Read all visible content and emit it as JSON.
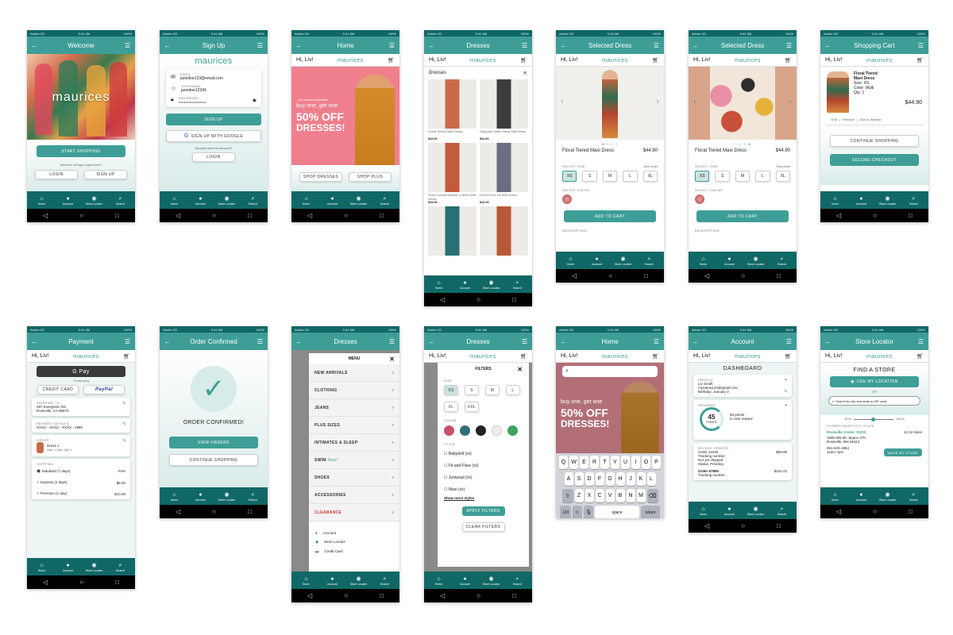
{
  "status": {
    "carrier": "Adobe XD",
    "time": "9:41 AM",
    "battery": "100%"
  },
  "brand": "maurices",
  "greeting": "Hi, Liv!",
  "nav": [
    {
      "label": "Home",
      "icon": "home-icon",
      "glyph": "⌂"
    },
    {
      "label": "Account",
      "icon": "account-icon",
      "glyph": "●"
    },
    {
      "label": "Store Locator",
      "icon": "location-pin-icon",
      "glyph": "◉"
    },
    {
      "label": "Search",
      "icon": "search-icon",
      "glyph": "⌕"
    }
  ],
  "screens": {
    "welcome": {
      "title": "Welcome",
      "logo": "maurices",
      "start": "START SHOPPING",
      "question": "Want the full app experience?",
      "login": "LOGIN",
      "signup": "SIGN UP"
    },
    "signup": {
      "title": "Sign Up",
      "email_label": "EMAIL",
      "email": "janedoe123@email.com",
      "user_label": "USERNAME",
      "user": "janedoe12345",
      "pass_label": "PASSWORD",
      "pass": "•••••••••••••••••••••••••",
      "signup": "SIGN UP",
      "google": "SIGN UP WITH GOOGLE",
      "have": "Already have an account?",
      "login": "LOGIN"
    },
    "home": {
      "title": "Home",
      "small": "your summer destination",
      "promo": "buy one, get one",
      "off": "50% OFF",
      "dresses": "DRESSES!",
      "shop_dresses": "SHOP DRESSES",
      "shop_plus": "SHOP PLUS"
    },
    "dresses": {
      "title": "Dresses",
      "heading": "Dresses",
      "items": [
        {
          "name": "Floral Tiered Maxi Dress",
          "price": "$44.90",
          "color": "#c96b4a"
        },
        {
          "name": "Gingham Halter Neck Midi Dress",
          "price": "$44.90",
          "color": "#3c3c3c"
        },
        {
          "name": "Solid Crochet Bodice V Neck Midi Dress",
          "price": "$44.90",
          "color": "#c45a3e"
        },
        {
          "name": "Floral Front Tie Midi Dress",
          "price": "$44.90",
          "color": "#6a6e80"
        },
        {
          "name": "",
          "price": "",
          "color": "#2a6f74"
        },
        {
          "name": "",
          "price": "",
          "color": "#b85a35"
        }
      ]
    },
    "selected1": {
      "title": "Selected Dress",
      "name": "Floral Tiered Maxi Dress",
      "price": "$44.90",
      "select_size": "SELECT SIZE",
      "size_chart": "Size chart",
      "sizes": [
        "XS",
        "S",
        "M",
        "L",
        "XL"
      ],
      "select_color": "SELECT COLOR",
      "add": "ADD TO CART",
      "desc": "DESCRIPTION"
    },
    "selected2": {
      "title": "Selected Dress",
      "name": "Floral Tiered Maxi Dress",
      "price": "$44.90",
      "select_size": "SELECT SIZE",
      "size_chart": "Size chart",
      "sizes": [
        "XS",
        "S",
        "M",
        "L",
        "XL"
      ],
      "select_color": "SELECT COLOR",
      "add": "ADD TO CART",
      "desc": "DESCRIPTION"
    },
    "cart": {
      "title": "Shopping Cart",
      "item": "Floral Tiered Maxi Dress",
      "size": "Size: XS",
      "color": "Color: Multi",
      "qty": "Qty: 1",
      "price": "$44.90",
      "edit": "Edit",
      "remove": "Remove",
      "wish": "Add to Wishlist",
      "continue": "CONTINUE SHOPPING",
      "checkout": "SECURE CHECKOUT"
    },
    "payment": {
      "title": "Payment",
      "gpay": "G Pay",
      "or": "Or pay using",
      "credit": "CREDIT CARD",
      "paypal": "PayPal",
      "ship_label": "SHIPPING TO:",
      "ship1": "497 Evergreen Rd.",
      "ship2": "Roseville, CA 95673",
      "pay_label": "PAYMENT DETAILS",
      "card": "XXXX - XXXX - XXXX - 1980",
      "order_label": "ORDER",
      "order_item": "Dress 1",
      "order_meta": "Size, Color, Qty 1",
      "shipping_label": "SHIPPING",
      "options": [
        {
          "name": "Standard (7 days)",
          "price": "Free"
        },
        {
          "name": "Express (2 days)",
          "price": "$5.00"
        },
        {
          "name": "Premium (1 day)",
          "price": "$10.00"
        }
      ]
    },
    "confirmed": {
      "title": "Order Confirmed",
      "msg": "ORDER CONFIRMED!",
      "view": "VIEW ORDERS",
      "continue": "CONTINUE SHOPPING"
    },
    "menu": {
      "title": "Dresses",
      "menu": "MENU",
      "items": [
        "NEW ARRIVALS",
        "CLOTHING",
        "JEANS",
        "PLUS SIZES",
        "INTIMATES & SLEEP",
        "SWIM",
        "SHOES",
        "ACCESSORIES",
        "CLEARANCE"
      ],
      "swim_new": "New!",
      "links": [
        "Account",
        "Store Locator",
        "Credit Card"
      ]
    },
    "filters": {
      "title": "Dresses",
      "heading": "FILTERS",
      "size": "SIZE",
      "sizes": [
        "XS",
        "S",
        "M",
        "L",
        "XL",
        "XXL"
      ],
      "color": "COLOR",
      "style": "STYLE",
      "styles": [
        "Babydoll (xx)",
        "Fit and Flare (xx)",
        "Jumpsuit (xx)",
        "Maxi (xx)"
      ],
      "more": "Show more styles",
      "apply": "APPLY FILTERS",
      "clear": "CLEAR FILTERS"
    },
    "search": {
      "title": "Home",
      "promo": "buy one, get one",
      "off": "50% OFF",
      "dresses": "DRESSES!",
      "rows": [
        [
          "Q",
          "W",
          "E",
          "R",
          "T",
          "Y",
          "U",
          "I",
          "O",
          "P"
        ],
        [
          "A",
          "S",
          "D",
          "F",
          "G",
          "H",
          "J",
          "K",
          "L"
        ],
        [
          "Z",
          "X",
          "C",
          "V",
          "B",
          "N",
          "M"
        ]
      ],
      "num": "123",
      "space": "space",
      "ret": "return"
    },
    "account": {
      "title": "Account",
      "dashboard": "DASHBOARD",
      "profile": "PROFILE",
      "pname": "Liv Smith",
      "pemail": "myname123@gmail.com",
      "bday": "Birthday: January 2",
      "rewards": "REWARDS",
      "points": "45",
      "points_lbl": "POINTS",
      "next": "55 points",
      "next2": "to next reward",
      "recent": "RECENT ORDERS",
      "o1": "Order 12345",
      "o1p": "$58.98",
      "o1t": "Tracking number:",
      "o1s": "Not yet shipped",
      "o1st": "Status: Pending",
      "o2": "Order 67890",
      "o2p": "$102.43",
      "o2t": "Tracking number:"
    },
    "store": {
      "title": "Store Locator",
      "find": "FIND A STORE",
      "use": "USE MY LOCATION",
      "or": "OR",
      "search": "Search by city and state or ZIP code",
      "r1": "25 mi",
      "r2": "100 mi",
      "near": "STORES NEAR CITY, STATE",
      "sname": "Roseville Center #2220",
      "dist": "12.34 miles",
      "a1": "1595 MN-36, Space 470,",
      "a2": "Roseville, MN 55113",
      "phone": "651-633-1964",
      "hours": "11am-7pm",
      "make": "MAKE MY STORE"
    }
  },
  "colors": {
    "teal": "#3e9e97",
    "dark": "#106866",
    "swatches": [
      "#c9506a",
      "#2f6f78",
      "#222222",
      "#eeeeee",
      "#3fa35c"
    ]
  }
}
